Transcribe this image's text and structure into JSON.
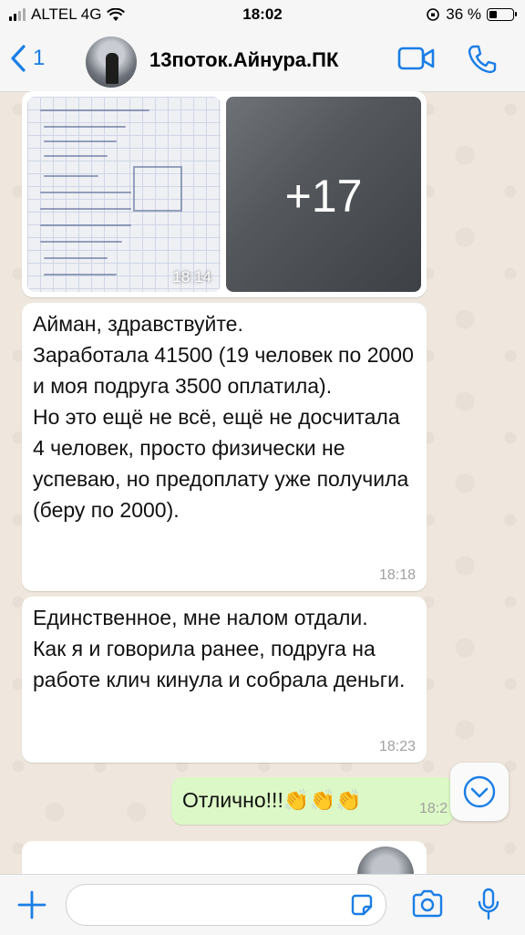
{
  "status_bar": {
    "carrier": "ALTEL 4G",
    "time": "18:02",
    "battery": "36 %",
    "battery_level": 0.36
  },
  "header": {
    "back_count": "1",
    "contact_name": "13поток.Айнура.ПК"
  },
  "messages": [
    {
      "type": "photo",
      "time": "18:14",
      "more_count": "+17"
    },
    {
      "type": "text",
      "text": "Айман, здравствуйте.\nЗаработала 41500 (19 человек по 2000 и моя подруга 3500 оплатила).\nНо это ещё не всё, ещё не досчитала 4 человек, просто физически не успеваю, но предоплату уже получила (беру по 2000).",
      "time": "18:18"
    },
    {
      "type": "text",
      "text": "Единственное, мне налом отдали.\nКак я и говорила ранее, подруга на работе клич кинула и собрала деньги.",
      "time": "18:23"
    },
    {
      "type": "outgoing",
      "text": "Отлично!!!👏👏👏",
      "time": "18:2"
    }
  ],
  "colors": {
    "accent": "#1a7ee6",
    "outgoing_bubble": "#dcf8c6",
    "incoming_bubble": "#ffffff"
  },
  "icons": {
    "back": "chevron-left-icon",
    "video": "video-camera-icon",
    "call": "phone-icon",
    "scroll": "chevron-down-icon",
    "attach": "plus-icon",
    "sticker": "sticker-icon",
    "camera": "camera-icon",
    "mic": "microphone-icon"
  }
}
